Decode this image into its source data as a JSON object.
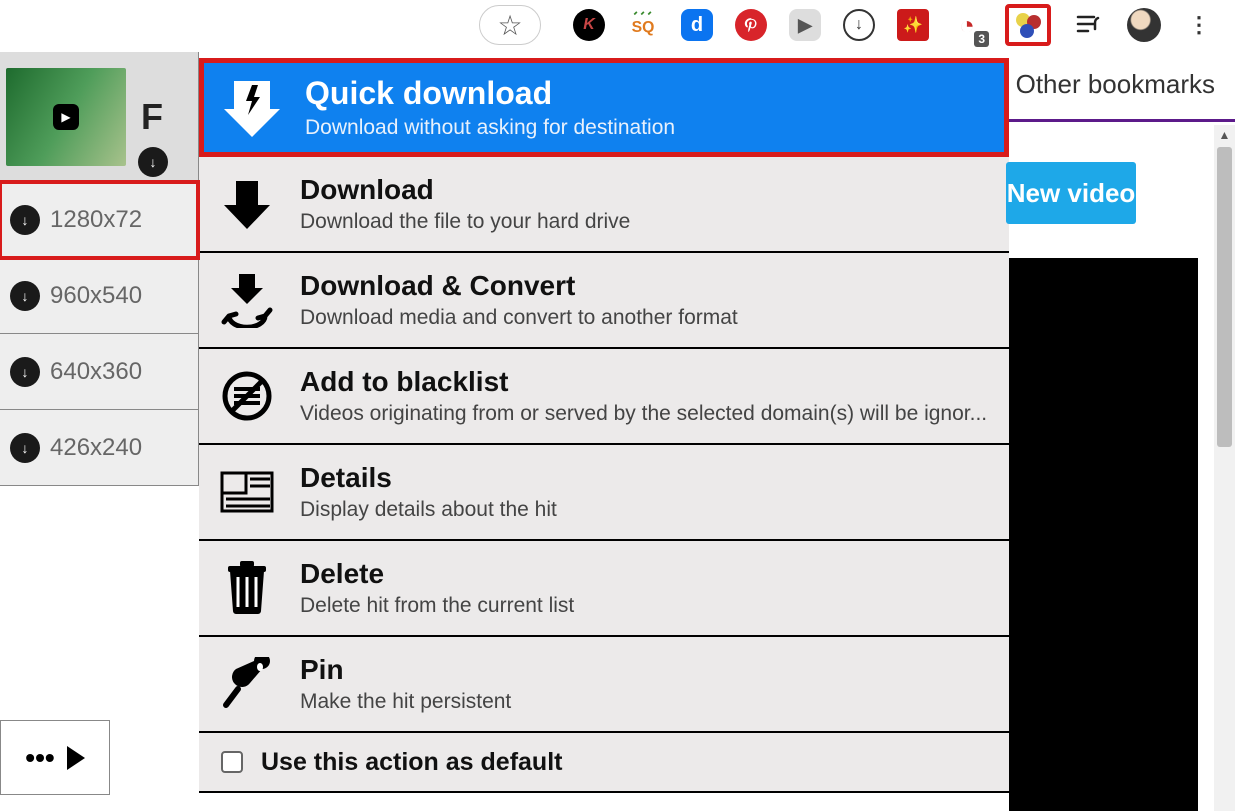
{
  "toolbar": {
    "badge_count": "3"
  },
  "bookmarks": {
    "other_label": "Other bookmarks"
  },
  "sidebar": {
    "thumb_title_char": "F",
    "resolutions": [
      "1280x72",
      "960x540",
      "640x360",
      "426x240"
    ],
    "bottom_more": "•••"
  },
  "menu": {
    "items": [
      {
        "title": "Quick download",
        "desc": "Download without asking for destination",
        "icon": "lightning-down"
      },
      {
        "title": "Download",
        "desc": "Download the file to your hard drive",
        "icon": "down-arrow"
      },
      {
        "title": "Download & Convert",
        "desc": "Download media and convert to another format",
        "icon": "convert"
      },
      {
        "title": "Add to blacklist",
        "desc": "Videos originating from or served by the selected domain(s) will be ignor...",
        "icon": "blacklist"
      },
      {
        "title": "Details",
        "desc": "Display details about the hit",
        "icon": "details"
      },
      {
        "title": "Delete",
        "desc": "Delete hit from the current list",
        "icon": "trash"
      },
      {
        "title": "Pin",
        "desc": "Make the hit persistent",
        "icon": "pin"
      }
    ],
    "default_label": "Use this action as default"
  },
  "right": {
    "new_video": "New video"
  }
}
